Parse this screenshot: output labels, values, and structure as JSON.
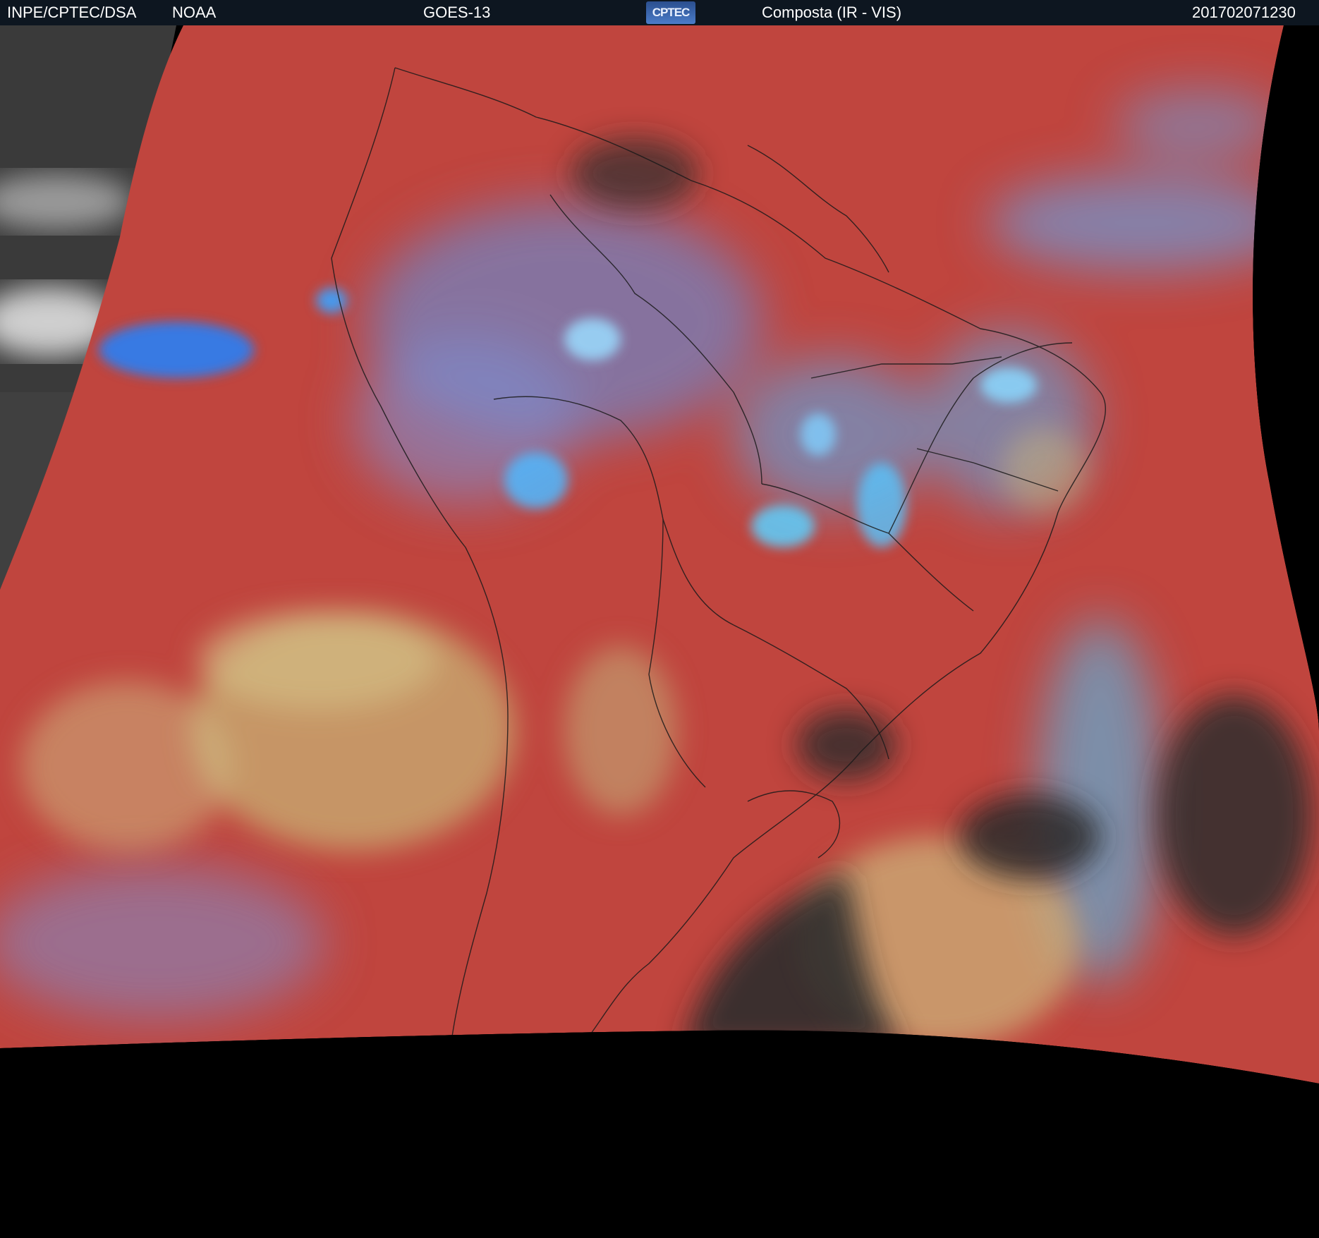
{
  "header": {
    "agency": "INPE/CPTEC/DSA",
    "source": "NOAA",
    "satellite": "GOES-13",
    "logo_text": "CPTEC",
    "product": "Composta (IR - VIS)",
    "timestamp": "201702071230"
  },
  "colors": {
    "header_bg": "#0d1620",
    "land_red": "#c0453e",
    "cloud_blue": "#3fa6f0",
    "cloud_yellow": "#c9b878",
    "space_black": "#000000",
    "ir_gray": "#4a4a4a"
  },
  "icons": {
    "logo": "cptec-logo"
  }
}
